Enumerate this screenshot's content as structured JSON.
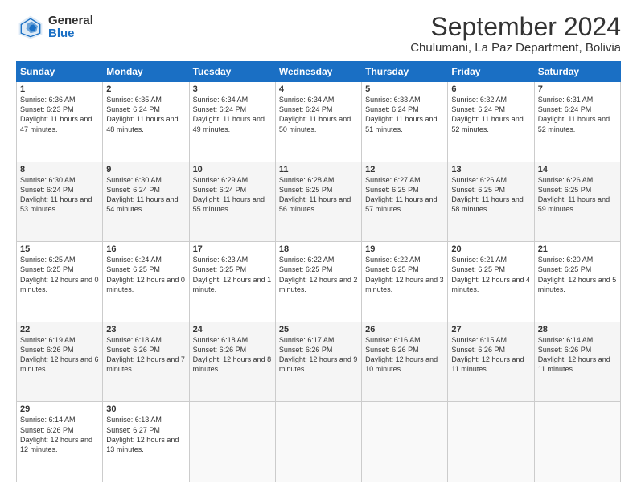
{
  "logo": {
    "general": "General",
    "blue": "Blue"
  },
  "title": "September 2024",
  "subtitle": "Chulumani, La Paz Department, Bolivia",
  "weekdays": [
    "Sunday",
    "Monday",
    "Tuesday",
    "Wednesday",
    "Thursday",
    "Friday",
    "Saturday"
  ],
  "weeks": [
    [
      {
        "day": "1",
        "sunrise": "Sunrise: 6:36 AM",
        "sunset": "Sunset: 6:23 PM",
        "daylight": "Daylight: 11 hours and 47 minutes."
      },
      {
        "day": "2",
        "sunrise": "Sunrise: 6:35 AM",
        "sunset": "Sunset: 6:24 PM",
        "daylight": "Daylight: 11 hours and 48 minutes."
      },
      {
        "day": "3",
        "sunrise": "Sunrise: 6:34 AM",
        "sunset": "Sunset: 6:24 PM",
        "daylight": "Daylight: 11 hours and 49 minutes."
      },
      {
        "day": "4",
        "sunrise": "Sunrise: 6:34 AM",
        "sunset": "Sunset: 6:24 PM",
        "daylight": "Daylight: 11 hours and 50 minutes."
      },
      {
        "day": "5",
        "sunrise": "Sunrise: 6:33 AM",
        "sunset": "Sunset: 6:24 PM",
        "daylight": "Daylight: 11 hours and 51 minutes."
      },
      {
        "day": "6",
        "sunrise": "Sunrise: 6:32 AM",
        "sunset": "Sunset: 6:24 PM",
        "daylight": "Daylight: 11 hours and 52 minutes."
      },
      {
        "day": "7",
        "sunrise": "Sunrise: 6:31 AM",
        "sunset": "Sunset: 6:24 PM",
        "daylight": "Daylight: 11 hours and 52 minutes."
      }
    ],
    [
      {
        "day": "8",
        "sunrise": "Sunrise: 6:30 AM",
        "sunset": "Sunset: 6:24 PM",
        "daylight": "Daylight: 11 hours and 53 minutes."
      },
      {
        "day": "9",
        "sunrise": "Sunrise: 6:30 AM",
        "sunset": "Sunset: 6:24 PM",
        "daylight": "Daylight: 11 hours and 54 minutes."
      },
      {
        "day": "10",
        "sunrise": "Sunrise: 6:29 AM",
        "sunset": "Sunset: 6:24 PM",
        "daylight": "Daylight: 11 hours and 55 minutes."
      },
      {
        "day": "11",
        "sunrise": "Sunrise: 6:28 AM",
        "sunset": "Sunset: 6:25 PM",
        "daylight": "Daylight: 11 hours and 56 minutes."
      },
      {
        "day": "12",
        "sunrise": "Sunrise: 6:27 AM",
        "sunset": "Sunset: 6:25 PM",
        "daylight": "Daylight: 11 hours and 57 minutes."
      },
      {
        "day": "13",
        "sunrise": "Sunrise: 6:26 AM",
        "sunset": "Sunset: 6:25 PM",
        "daylight": "Daylight: 11 hours and 58 minutes."
      },
      {
        "day": "14",
        "sunrise": "Sunrise: 6:26 AM",
        "sunset": "Sunset: 6:25 PM",
        "daylight": "Daylight: 11 hours and 59 minutes."
      }
    ],
    [
      {
        "day": "15",
        "sunrise": "Sunrise: 6:25 AM",
        "sunset": "Sunset: 6:25 PM",
        "daylight": "Daylight: 12 hours and 0 minutes."
      },
      {
        "day": "16",
        "sunrise": "Sunrise: 6:24 AM",
        "sunset": "Sunset: 6:25 PM",
        "daylight": "Daylight: 12 hours and 0 minutes."
      },
      {
        "day": "17",
        "sunrise": "Sunrise: 6:23 AM",
        "sunset": "Sunset: 6:25 PM",
        "daylight": "Daylight: 12 hours and 1 minute."
      },
      {
        "day": "18",
        "sunrise": "Sunrise: 6:22 AM",
        "sunset": "Sunset: 6:25 PM",
        "daylight": "Daylight: 12 hours and 2 minutes."
      },
      {
        "day": "19",
        "sunrise": "Sunrise: 6:22 AM",
        "sunset": "Sunset: 6:25 PM",
        "daylight": "Daylight: 12 hours and 3 minutes."
      },
      {
        "day": "20",
        "sunrise": "Sunrise: 6:21 AM",
        "sunset": "Sunset: 6:25 PM",
        "daylight": "Daylight: 12 hours and 4 minutes."
      },
      {
        "day": "21",
        "sunrise": "Sunrise: 6:20 AM",
        "sunset": "Sunset: 6:25 PM",
        "daylight": "Daylight: 12 hours and 5 minutes."
      }
    ],
    [
      {
        "day": "22",
        "sunrise": "Sunrise: 6:19 AM",
        "sunset": "Sunset: 6:26 PM",
        "daylight": "Daylight: 12 hours and 6 minutes."
      },
      {
        "day": "23",
        "sunrise": "Sunrise: 6:18 AM",
        "sunset": "Sunset: 6:26 PM",
        "daylight": "Daylight: 12 hours and 7 minutes."
      },
      {
        "day": "24",
        "sunrise": "Sunrise: 6:18 AM",
        "sunset": "Sunset: 6:26 PM",
        "daylight": "Daylight: 12 hours and 8 minutes."
      },
      {
        "day": "25",
        "sunrise": "Sunrise: 6:17 AM",
        "sunset": "Sunset: 6:26 PM",
        "daylight": "Daylight: 12 hours and 9 minutes."
      },
      {
        "day": "26",
        "sunrise": "Sunrise: 6:16 AM",
        "sunset": "Sunset: 6:26 PM",
        "daylight": "Daylight: 12 hours and 10 minutes."
      },
      {
        "day": "27",
        "sunrise": "Sunrise: 6:15 AM",
        "sunset": "Sunset: 6:26 PM",
        "daylight": "Daylight: 12 hours and 11 minutes."
      },
      {
        "day": "28",
        "sunrise": "Sunrise: 6:14 AM",
        "sunset": "Sunset: 6:26 PM",
        "daylight": "Daylight: 12 hours and 11 minutes."
      }
    ],
    [
      {
        "day": "29",
        "sunrise": "Sunrise: 6:14 AM",
        "sunset": "Sunset: 6:26 PM",
        "daylight": "Daylight: 12 hours and 12 minutes."
      },
      {
        "day": "30",
        "sunrise": "Sunrise: 6:13 AM",
        "sunset": "Sunset: 6:27 PM",
        "daylight": "Daylight: 12 hours and 13 minutes."
      },
      {
        "day": "",
        "sunrise": "",
        "sunset": "",
        "daylight": ""
      },
      {
        "day": "",
        "sunrise": "",
        "sunset": "",
        "daylight": ""
      },
      {
        "day": "",
        "sunrise": "",
        "sunset": "",
        "daylight": ""
      },
      {
        "day": "",
        "sunrise": "",
        "sunset": "",
        "daylight": ""
      },
      {
        "day": "",
        "sunrise": "",
        "sunset": "",
        "daylight": ""
      }
    ]
  ]
}
